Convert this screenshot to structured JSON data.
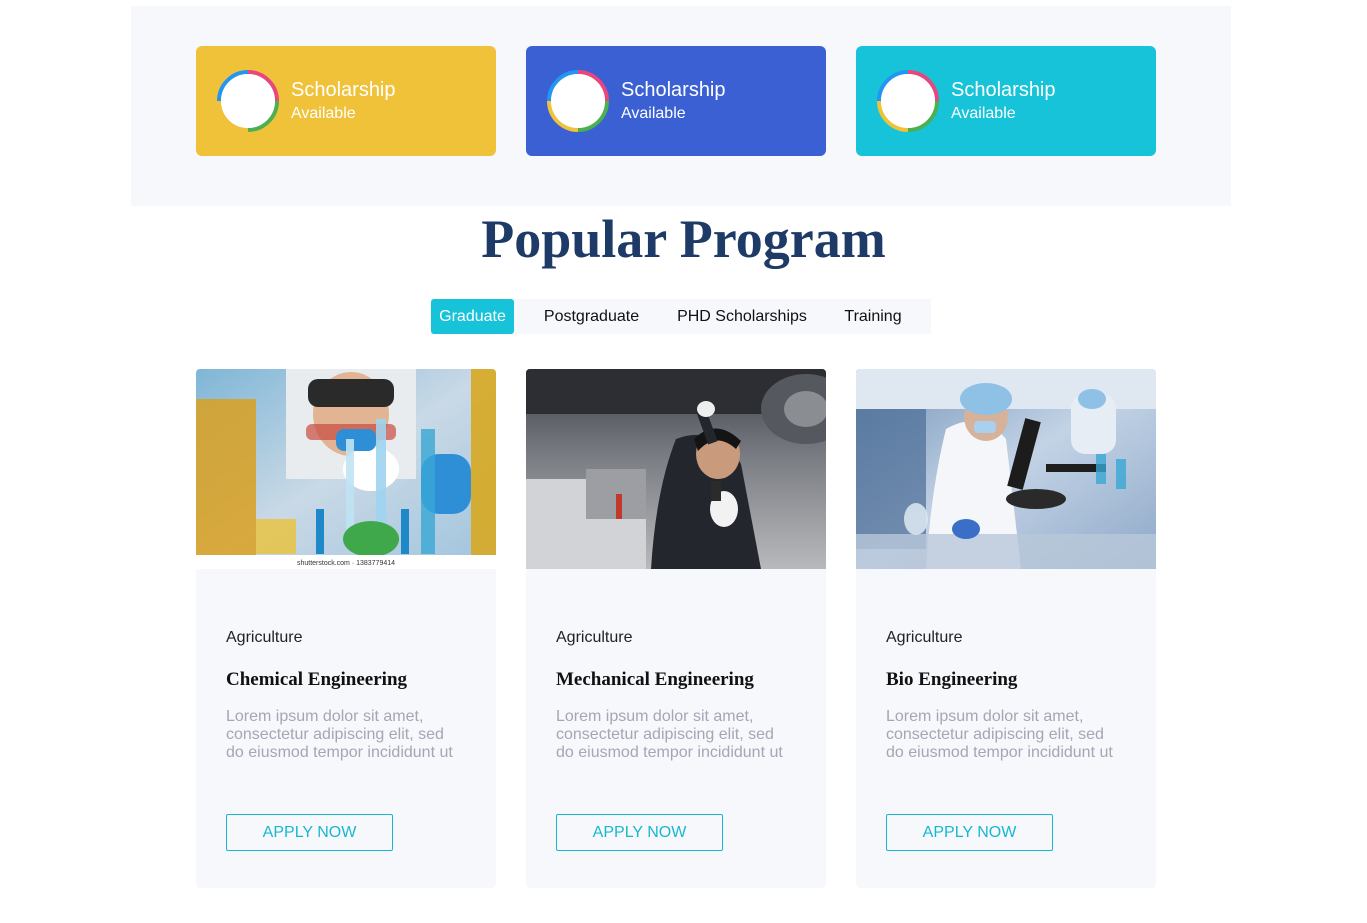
{
  "colors": {
    "card_yellow": "#f0c23a",
    "card_blue": "#3a60d4",
    "card_cyan": "#17c3d8",
    "title_navy": "#1e3a66",
    "accent_cyan": "#17c3d8"
  },
  "scholarship_cards": [
    {
      "title": "Scholarship",
      "subtitle": "Available",
      "icon": "scholarship-ring-icon"
    },
    {
      "title": "Scholarship",
      "subtitle": "Available",
      "icon": "scholarship-ring-icon"
    },
    {
      "title": "Scholarship",
      "subtitle": "Available",
      "icon": "scholarship-ring-icon"
    }
  ],
  "section": {
    "title": "Popular Program"
  },
  "tabs": [
    {
      "label": "Graduate",
      "active": true
    },
    {
      "label": "Postgraduate",
      "active": false
    },
    {
      "label": "PHD Scholarships",
      "active": false
    },
    {
      "label": "Training",
      "active": false
    }
  ],
  "programs": [
    {
      "image": "chemistry-lab-photo",
      "image_caption": "shutterstock.com · 1383779414",
      "category": "Agriculture",
      "title": "Chemical Engineering",
      "description": "Lorem ipsum dolor sit amet, consectetur adipiscing elit, sed do eiusmod tempor incididunt ut",
      "button": "APPLY NOW"
    },
    {
      "image": "mechanic-under-car-photo",
      "category": "Agriculture",
      "title": "Mechanical Engineering",
      "description": "Lorem ipsum dolor sit amet, consectetur adipiscing elit, sed do eiusmod tempor incididunt ut",
      "button": "APPLY NOW"
    },
    {
      "image": "biotech-lab-photo",
      "category": "Agriculture",
      "title": "Bio Engineering",
      "description": "Lorem ipsum dolor sit amet, consectetur adipiscing elit, sed do eiusmod tempor incididunt ut",
      "button": "APPLY NOW"
    }
  ]
}
